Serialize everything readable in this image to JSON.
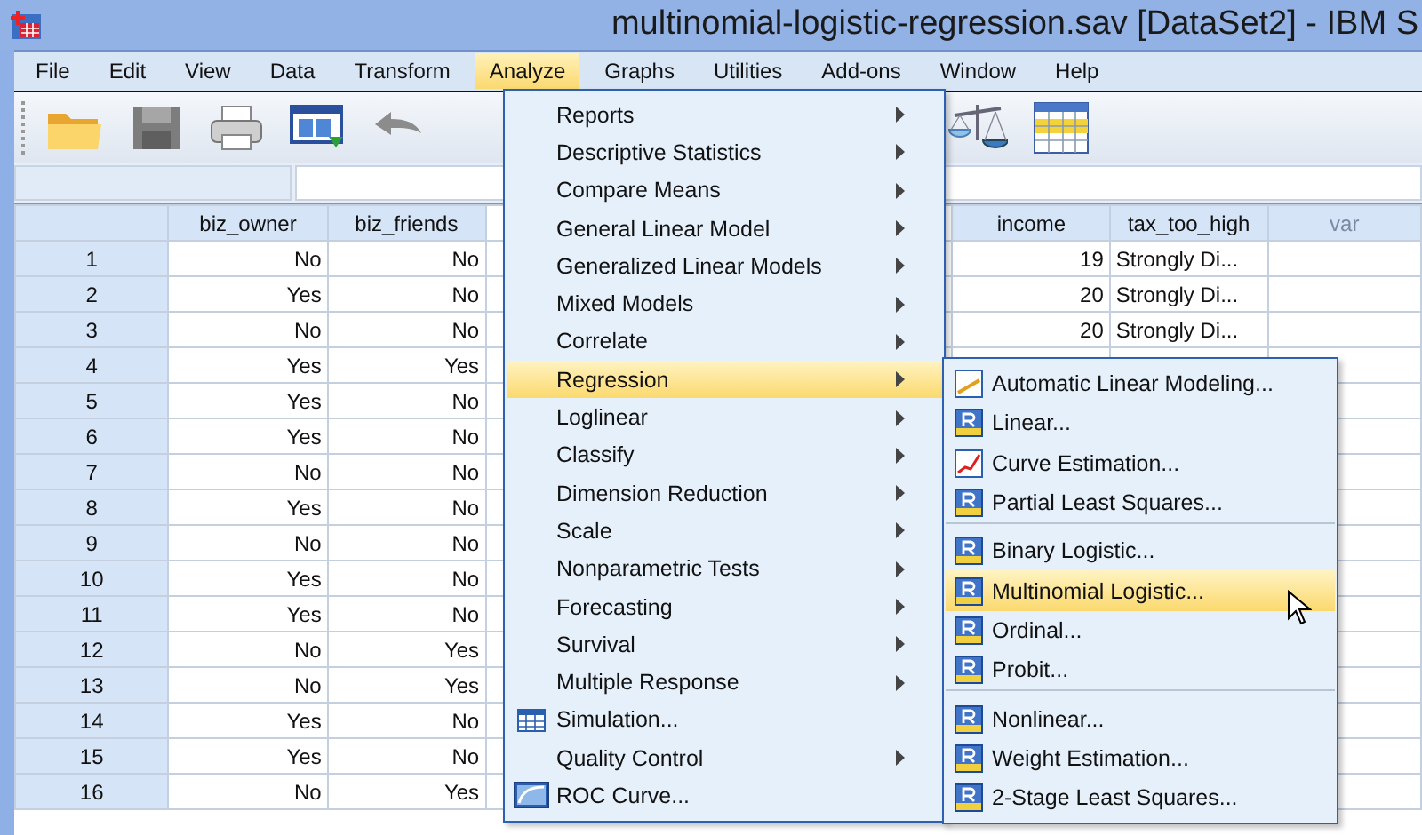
{
  "window": {
    "title": "multinomial-logistic-regression.sav [DataSet2] - IBM S"
  },
  "menu_bar": [
    {
      "label": "File",
      "selected": false
    },
    {
      "label": "Edit",
      "selected": false
    },
    {
      "label": "View",
      "selected": false
    },
    {
      "label": "Data",
      "selected": false
    },
    {
      "label": "Transform",
      "selected": false
    },
    {
      "label": "Analyze",
      "selected": true
    },
    {
      "label": "Graphs",
      "selected": false
    },
    {
      "label": "Utilities",
      "selected": false
    },
    {
      "label": "Add-ons",
      "selected": false
    },
    {
      "label": "Window",
      "selected": false
    },
    {
      "label": "Help",
      "selected": false
    }
  ],
  "grid": {
    "columns": [
      {
        "label": "biz_owner",
        "kind": "numeric"
      },
      {
        "label": "biz_friends",
        "kind": "numeric"
      },
      {
        "label": "income",
        "kind": "numeric"
      },
      {
        "label": "tax_too_high",
        "kind": "string"
      },
      {
        "label": "var",
        "kind": "empty"
      }
    ],
    "rows": [
      {
        "label": "1",
        "values": [
          "No",
          "No",
          "19",
          "Strongly Di..."
        ]
      },
      {
        "label": "2",
        "values": [
          "Yes",
          "No",
          "20",
          "Strongly Di..."
        ]
      },
      {
        "label": "3",
        "values": [
          "No",
          "No",
          "20",
          "Strongly Di..."
        ]
      },
      {
        "label": "4",
        "values": [
          "Yes",
          "Yes"
        ]
      },
      {
        "label": "5",
        "values": [
          "Yes",
          "No"
        ]
      },
      {
        "label": "6",
        "values": [
          "Yes",
          "No"
        ]
      },
      {
        "label": "7",
        "values": [
          "No",
          "No"
        ]
      },
      {
        "label": "8",
        "values": [
          "Yes",
          "No"
        ]
      },
      {
        "label": "9",
        "values": [
          "No",
          "No"
        ]
      },
      {
        "label": "10",
        "values": [
          "Yes",
          "No"
        ]
      },
      {
        "label": "11",
        "values": [
          "Yes",
          "No"
        ]
      },
      {
        "label": "12",
        "values": [
          "No",
          "Yes"
        ]
      },
      {
        "label": "13",
        "values": [
          "No",
          "Yes"
        ]
      },
      {
        "label": "14",
        "values": [
          "Yes",
          "No"
        ]
      },
      {
        "label": "15",
        "values": [
          "Yes",
          "No"
        ]
      },
      {
        "label": "16",
        "values": [
          "No",
          "Yes"
        ]
      }
    ]
  },
  "analyze_menu": [
    {
      "label": "Reports",
      "submenu": true,
      "selected": false
    },
    {
      "label": "Descriptive Statistics",
      "submenu": true,
      "selected": false
    },
    {
      "label": "Compare Means",
      "submenu": true,
      "selected": false
    },
    {
      "label": "General Linear Model",
      "submenu": true,
      "selected": false
    },
    {
      "label": "Generalized Linear Models",
      "submenu": true,
      "selected": false
    },
    {
      "label": "Mixed Models",
      "submenu": true,
      "selected": false
    },
    {
      "label": "Correlate",
      "submenu": true,
      "selected": false
    },
    {
      "label": "Regression",
      "submenu": true,
      "selected": true
    },
    {
      "label": "Loglinear",
      "submenu": true,
      "selected": false
    },
    {
      "label": "Classify",
      "submenu": true,
      "selected": false
    },
    {
      "label": "Dimension Reduction",
      "submenu": true,
      "selected": false
    },
    {
      "label": "Scale",
      "submenu": true,
      "selected": false
    },
    {
      "label": "Nonparametric Tests",
      "submenu": true,
      "selected": false
    },
    {
      "label": "Forecasting",
      "submenu": true,
      "selected": false
    },
    {
      "label": "Survival",
      "submenu": true,
      "selected": false
    },
    {
      "label": "Multiple Response",
      "submenu": true,
      "selected": false
    },
    {
      "label": "Simulation...",
      "submenu": false,
      "selected": false,
      "kind": "table"
    },
    {
      "label": "Quality Control",
      "submenu": true,
      "selected": false
    },
    {
      "label": "ROC Curve...",
      "submenu": false,
      "selected": false,
      "kind": "roc"
    }
  ],
  "regression_submenu": [
    {
      "label": "Automatic Linear Modeling...",
      "kind": "line",
      "selected": false,
      "separator_after": false
    },
    {
      "label": "Linear...",
      "kind": "r",
      "selected": false,
      "separator_after": false
    },
    {
      "label": "Curve Estimation...",
      "kind": "curve",
      "selected": false,
      "separator_after": false
    },
    {
      "label": "Partial Least Squares...",
      "kind": "r",
      "selected": false,
      "separator_after": true
    },
    {
      "label": "Binary Logistic...",
      "kind": "r",
      "selected": false,
      "separator_after": false
    },
    {
      "label": "Multinomial Logistic...",
      "kind": "r",
      "selected": true,
      "separator_after": false
    },
    {
      "label": "Ordinal...",
      "kind": "r",
      "selected": false,
      "separator_after": false
    },
    {
      "label": "Probit...",
      "kind": "r",
      "selected": false,
      "separator_after": true
    },
    {
      "label": "Nonlinear...",
      "kind": "r",
      "selected": false,
      "separator_after": false
    },
    {
      "label": "Weight Estimation...",
      "kind": "r",
      "selected": false,
      "separator_after": false
    },
    {
      "label": "2-Stage Least Squares...",
      "kind": "r",
      "selected": false,
      "separator_after": false
    }
  ]
}
